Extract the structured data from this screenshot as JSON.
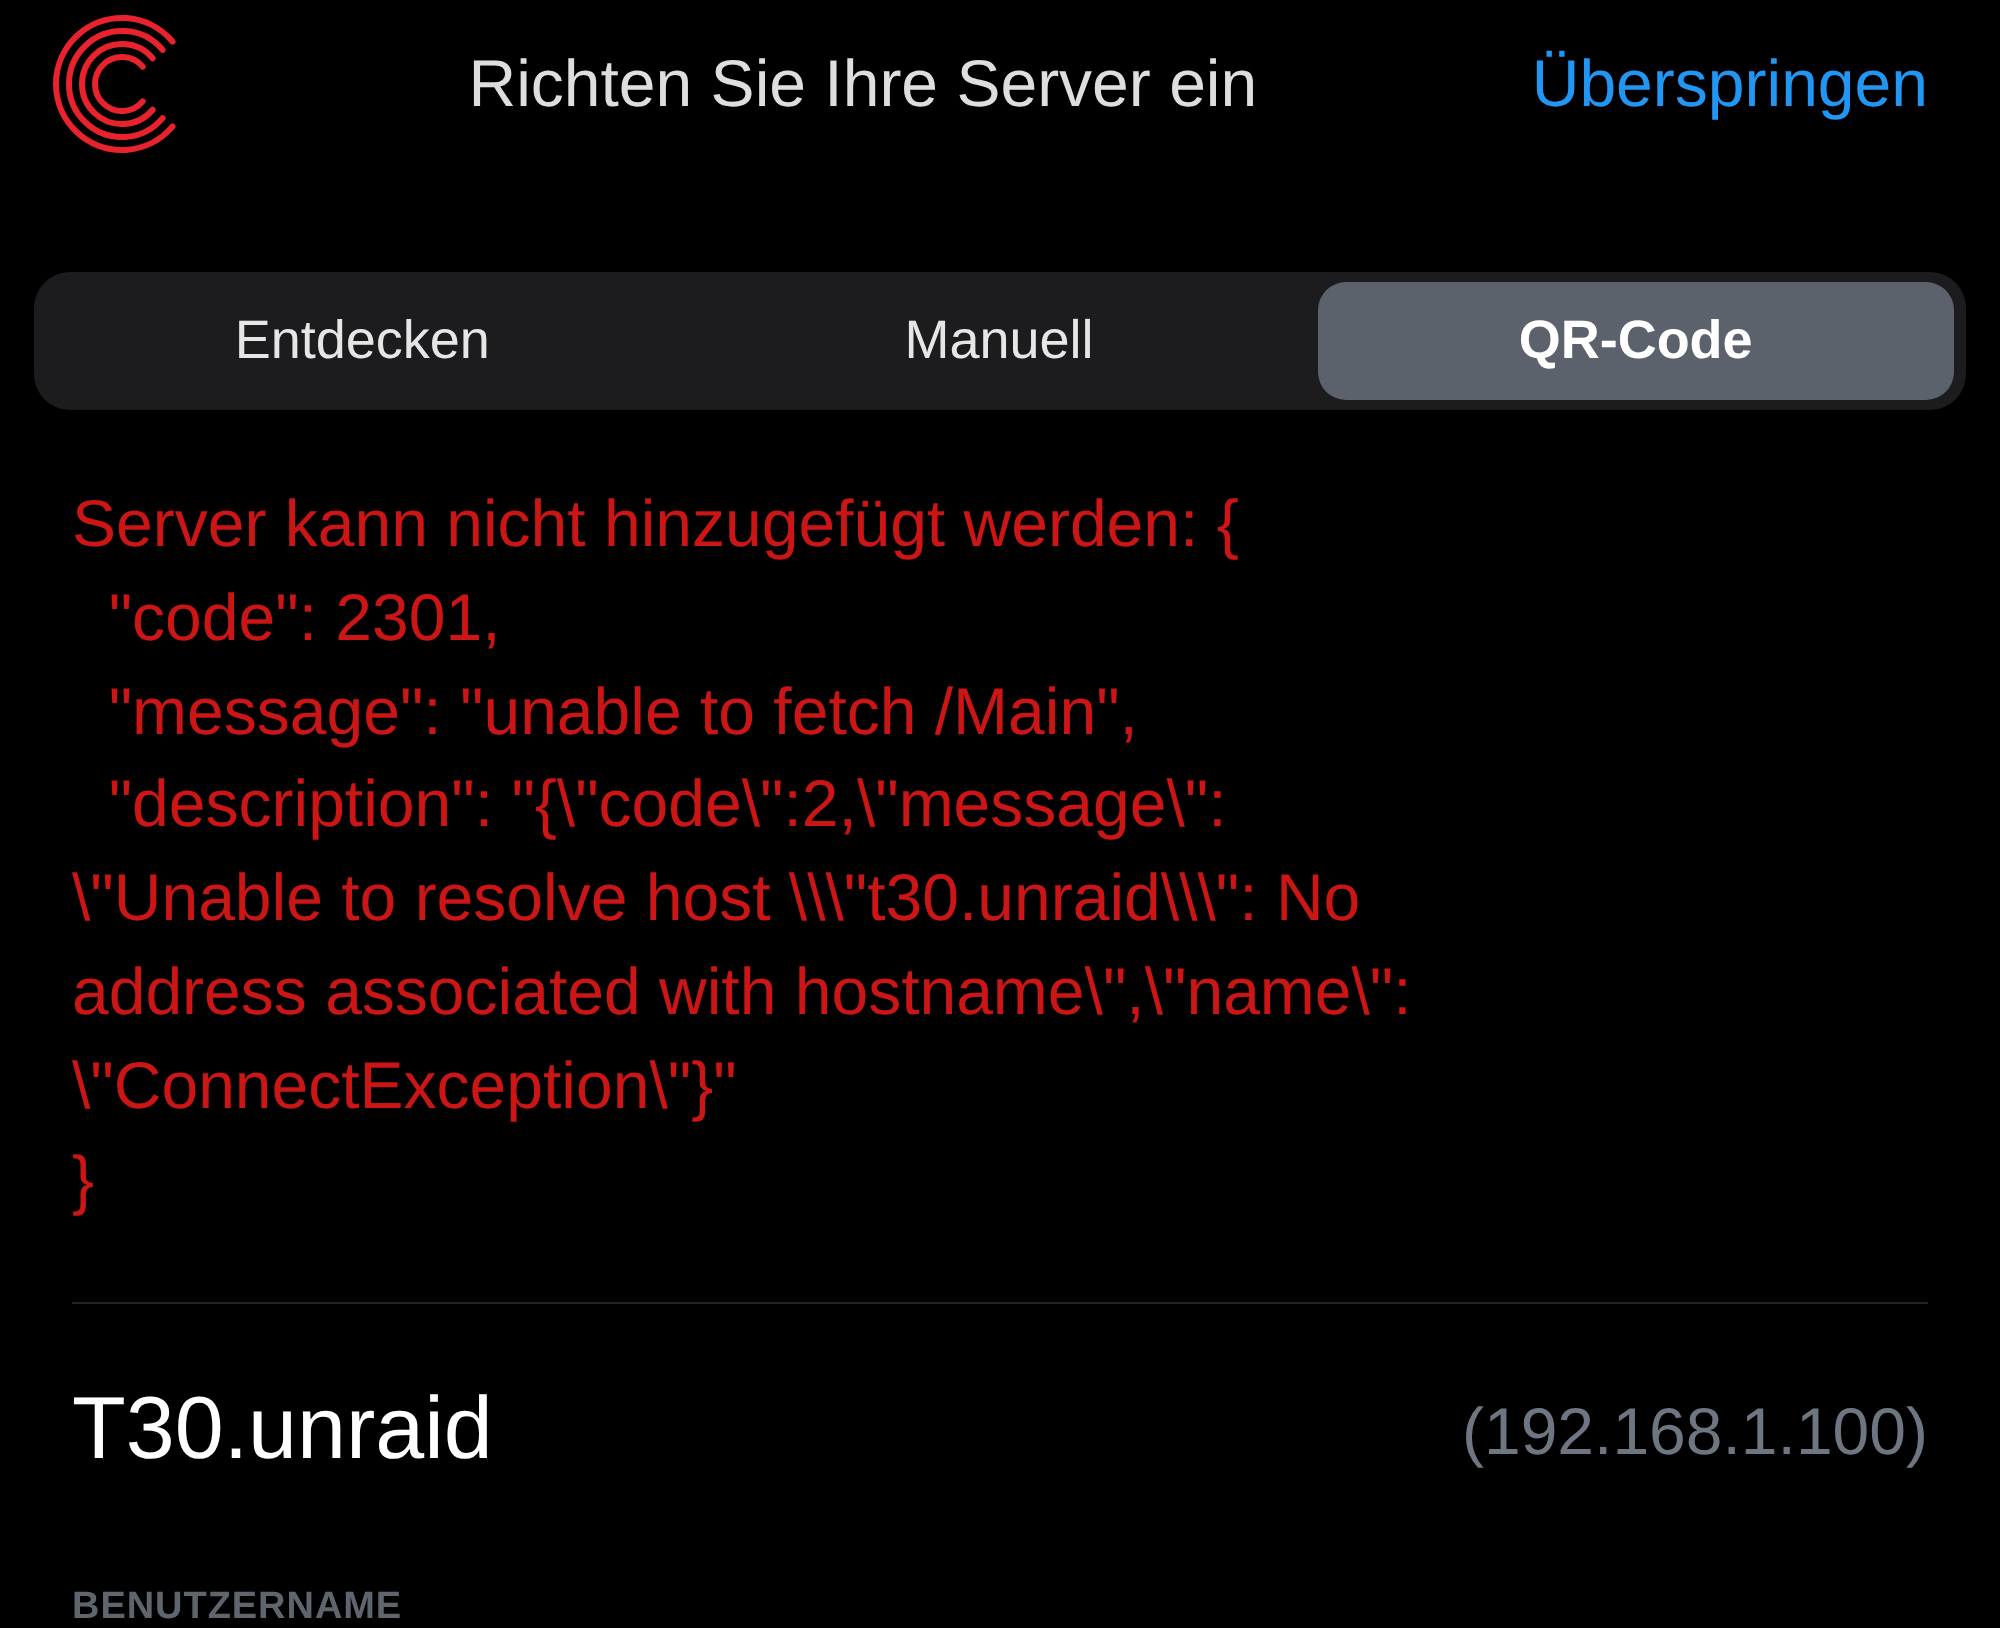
{
  "header": {
    "title": "Richten Sie Ihre Server ein",
    "skip_link": "Überspringen"
  },
  "tabs": [
    {
      "label": "Entdecken",
      "selected": false
    },
    {
      "label": "Manuell",
      "selected": false
    },
    {
      "label": "QR-Code",
      "selected": true
    }
  ],
  "error": {
    "lines": [
      "Server kann nicht hinzugefügt werden: {",
      "  \"code\": 2301,",
      "  \"message\": \"unable to fetch /Main\",",
      "  \"description\": \"{\\\"code\\\":2,\\\"message\\\":",
      "\\\"Unable to resolve host \\\\\\\"t30.unraid\\\\\\\": No",
      "address associated with hostname\\\",\\\"name\\\":",
      "\\\"ConnectException\\\"}\"",
      "}"
    ]
  },
  "server": {
    "name": "T30.unraid",
    "address": "(192.168.1.100)"
  },
  "fields": [
    {
      "label": "BENUTZERNAME"
    }
  ]
}
